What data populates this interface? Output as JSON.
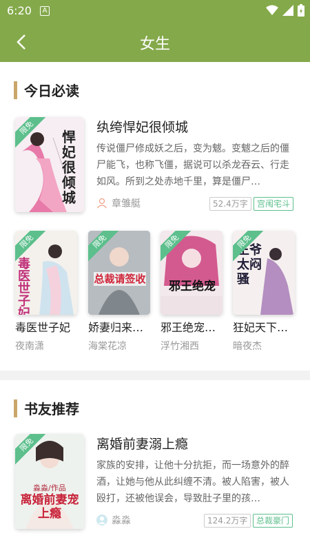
{
  "status": {
    "time": "6:20",
    "notif": "A"
  },
  "appbar": {
    "title": "女生"
  },
  "ribbon_label": "限免",
  "section1": {
    "title": "今日必读",
    "featured": {
      "title": "纨绔悍妃很倾城",
      "desc": "传说僵尸修成妖之后，变为魃。变魃之后的僵尸能飞，也称飞僵，据说可以杀龙吞云、行走如风。所到之处赤地千里，算是僵尸…",
      "author": "章雏艇",
      "words": "52.4万字",
      "category": "宫闱宅斗",
      "cover_text": "悍妃很倾城"
    },
    "grid": [
      {
        "title": "毒医世子妃",
        "author": "夜南潇",
        "cover_text": "毒医世子妃"
      },
      {
        "title": "娇妻归来…",
        "author": "海棠花凉",
        "cover_text": "总裁请签收"
      },
      {
        "title": "邪王绝宠…",
        "author": "浮竹湘西",
        "cover_text": "邪王绝宠"
      },
      {
        "title": "狂妃天下…",
        "author": "暗夜杰",
        "cover_text": "王爷太闷骚"
      }
    ]
  },
  "section2": {
    "title": "书友推荐",
    "featured": {
      "title": "离婚前妻溺上瘾",
      "desc": "家族的安排，让他十分抗拒，而一场意外的醉酒，让她与他从此纠缠不清。被人陷害，被人殴打，还被他误会，导致肚子里的孩…",
      "author": "淼淼",
      "words": "124.2万字",
      "category": "总裁豪门",
      "cover_text": "离婚前妻宠上瘾",
      "cover_subtitle": "淼淼/作品"
    }
  },
  "colors": {
    "appbar": "#84a94a",
    "accent_bar": "#c9a76b",
    "ribbon": "#5cbf8c"
  }
}
